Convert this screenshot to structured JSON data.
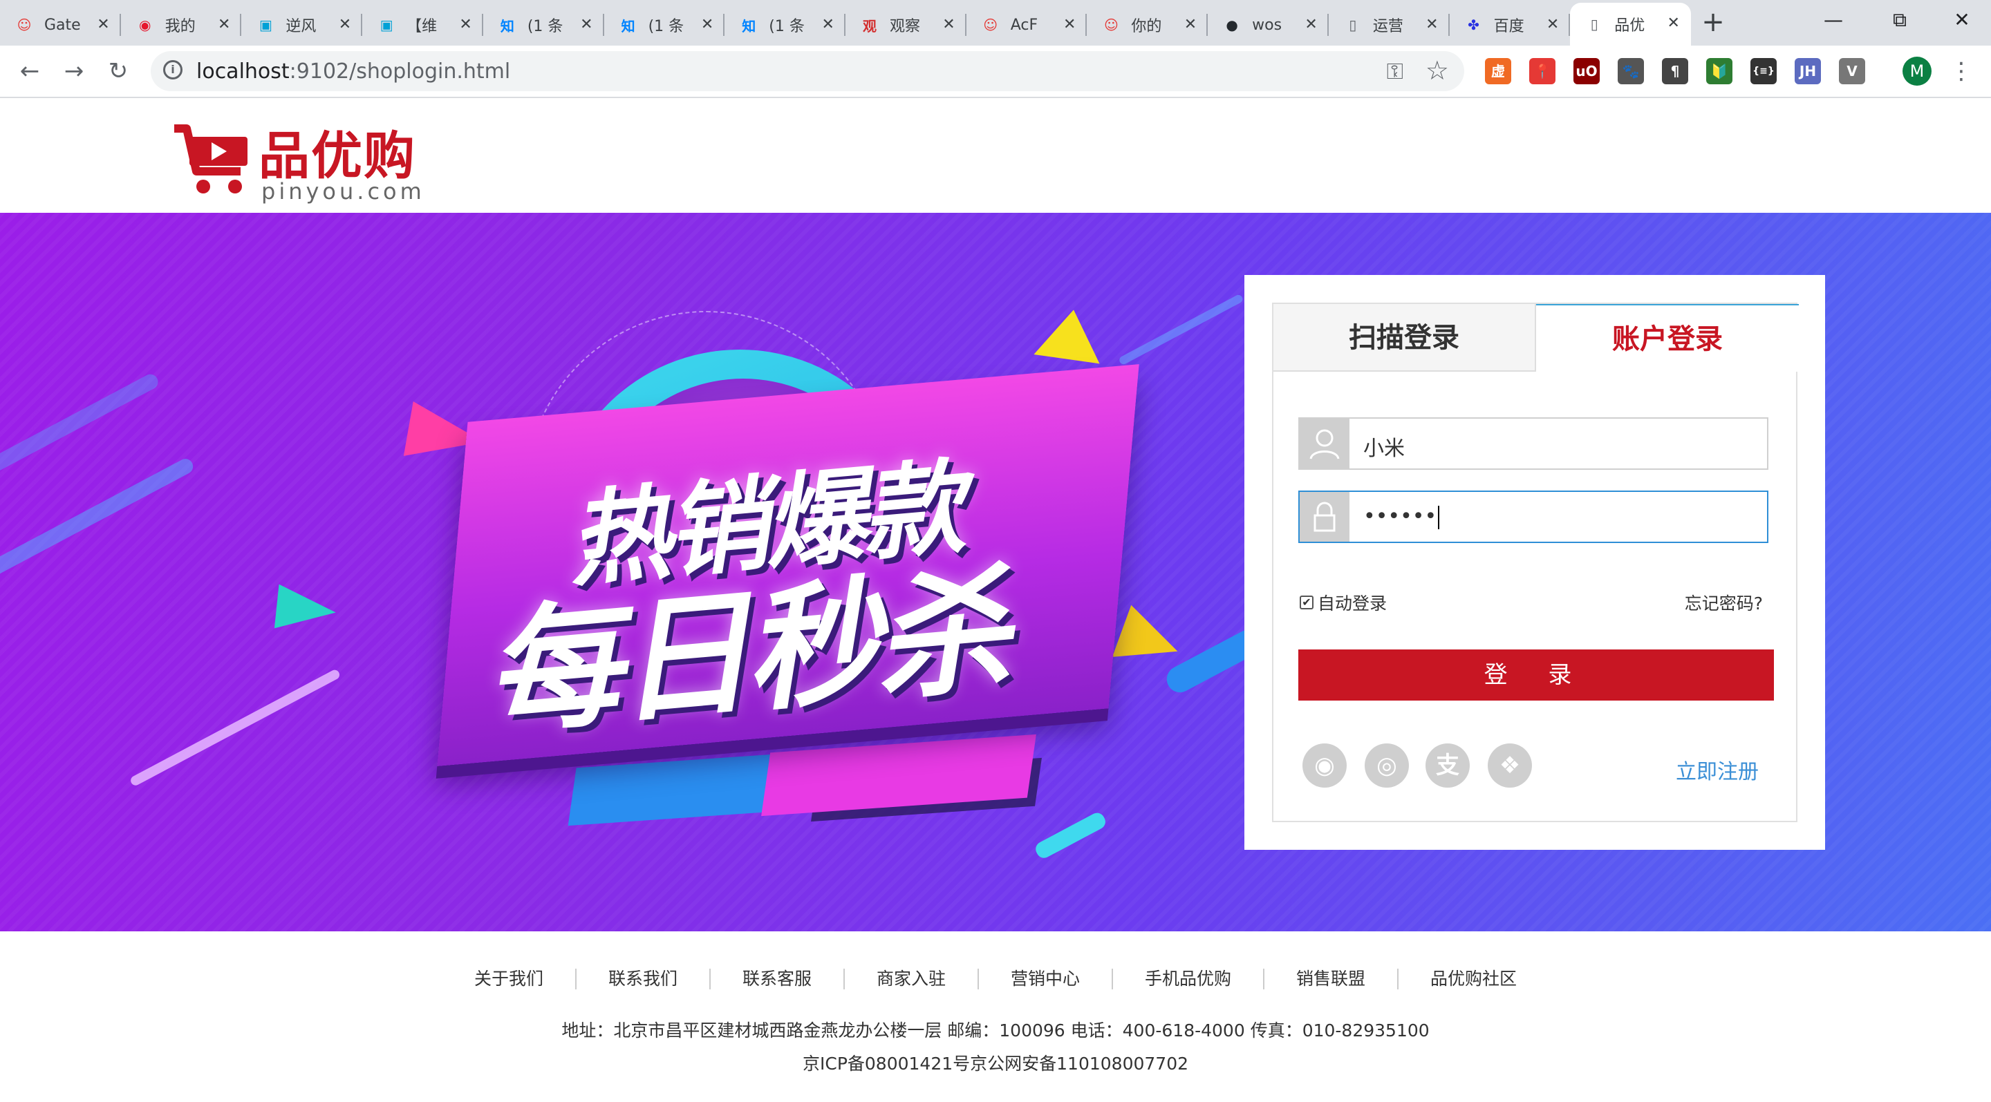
{
  "browser": {
    "tabs": [
      {
        "title": "Gate",
        "icon": "mascot-icon",
        "active": false
      },
      {
        "title": "我的",
        "icon": "weibo-icon",
        "active": false
      },
      {
        "title": "逆风",
        "icon": "bilibili-icon",
        "active": false
      },
      {
        "title": "【维",
        "icon": "bilibili-icon",
        "active": false
      },
      {
        "title": "(1 条",
        "icon": "zhihu-icon",
        "active": false
      },
      {
        "title": "(1 条",
        "icon": "zhihu-icon",
        "active": false
      },
      {
        "title": "(1 条",
        "icon": "zhihu-icon",
        "active": false
      },
      {
        "title": "观察",
        "icon": "guancha-icon",
        "active": false
      },
      {
        "title": "AcF",
        "icon": "mascot-icon",
        "active": false
      },
      {
        "title": "你的",
        "icon": "mascot-icon",
        "active": false
      },
      {
        "title": "wos",
        "icon": "github-icon",
        "active": false
      },
      {
        "title": "运营",
        "icon": "document-icon",
        "active": false
      },
      {
        "title": "百度",
        "icon": "baidu-icon",
        "active": false
      },
      {
        "title": "品优",
        "icon": "document-icon",
        "active": true
      }
    ],
    "url_host": "localhost",
    "url_path": ":9102/shoplogin.html",
    "profile_initial": "M",
    "extensions": [
      "虚",
      "📍",
      "uO",
      "🐾",
      "¶",
      "🔰",
      "{≡}",
      "JH",
      "V"
    ]
  },
  "logo": {
    "cn": "品优购",
    "en": "pinyou.com"
  },
  "banner": {
    "line1": "热销爆款",
    "line2": "每日秒杀"
  },
  "login": {
    "tab_scan": "扫描登录",
    "tab_account": "账户登录",
    "username_value": "小米",
    "password_value": "••••••",
    "remember_checked": true,
    "remember_label": "自动登录",
    "forgot_label": "忘记密码?",
    "submit_label": "登 录",
    "register_label": "立即注册",
    "social_icons": [
      "qq-icon",
      "weibo-icon",
      "alipay-icon",
      "wechat-icon"
    ]
  },
  "footer": {
    "links": [
      "关于我们",
      "联系我们",
      "联系客服",
      "商家入驻",
      "营销中心",
      "手机品优购",
      "销售联盟",
      "品优购社区"
    ],
    "address": "地址：北京市昌平区建材城西路金燕龙办公楼一层 邮编：100096 电话：400-618-4000 传真：010-82935100",
    "icp": "京ICP备08001421号京公网安备110108007702"
  },
  "colors": {
    "brand_red": "#c81623",
    "link_blue": "#3b8fd6",
    "banner_purple": "#8a2ae6"
  }
}
